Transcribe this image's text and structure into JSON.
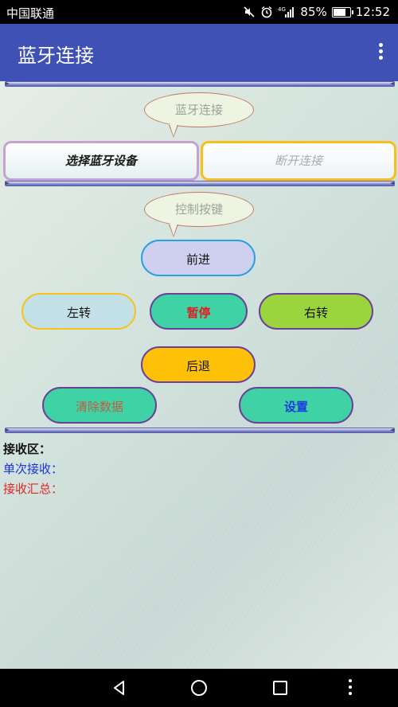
{
  "status_bar": {
    "carrier": "中国联通",
    "network": "4G",
    "battery_text": "85%",
    "battery_level": 0.85,
    "time": "12:52",
    "icons": [
      "mute-icon",
      "alarm-icon",
      "signal-icon",
      "battery-icon"
    ]
  },
  "app_bar": {
    "title": "蓝牙连接",
    "menu_icon": "overflow-menu-icon",
    "color": "#3f51b5"
  },
  "main": {
    "bluetooth_bubble": "蓝牙连接",
    "select_device_button": "选择蓝牙设备",
    "disconnect_button": "断开连接",
    "control_bubble": "控制按键",
    "controls": {
      "forward": "前进",
      "left": "左转",
      "pause": "暂停",
      "right": "右转",
      "back": "后退",
      "clear": "清除数据",
      "settings": "设置"
    },
    "receive": {
      "area_label": "接收区：",
      "single_label": "单次接收：",
      "summary_label": "接收汇总："
    }
  },
  "nav_bar": {
    "icons": [
      "back-icon",
      "home-icon",
      "recent-apps-icon",
      "more-icon"
    ]
  }
}
